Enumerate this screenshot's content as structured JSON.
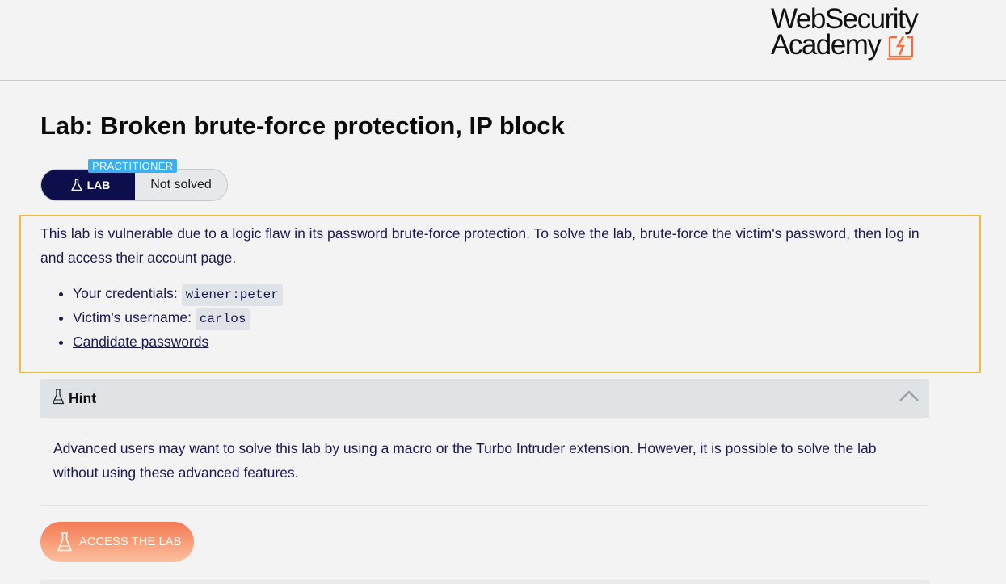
{
  "logo": {
    "line1": "WebSecurity",
    "line2": "Academy",
    "accent_color": "#ff6633"
  },
  "lab": {
    "title": "Lab: Broken brute-force protection, IP block",
    "badge_label": "LAB",
    "level": "PRACTITIONER",
    "status": "Not solved",
    "level_color": "#3ab0f3",
    "badge_color": "#0d0f4d"
  },
  "description": {
    "paragraph": "This lab is vulnerable due to a logic flaw in its password brute-force protection. To solve the lab, brute-force the victim's password, then log in and access their account page.",
    "items": [
      {
        "label": "Your credentials: ",
        "code": "wiener:peter"
      },
      {
        "label": "Victim's username: ",
        "code": "carlos"
      }
    ],
    "link_label": "Candidate passwords",
    "highlight_color": "#f6ba3c"
  },
  "hint": {
    "label": "Hint",
    "text": "Advanced users may want to solve this lab by using a macro or the Turbo Intruder extension. However, it is possible to solve the lab without using these advanced features.",
    "expanded": true
  },
  "actions": {
    "access_label": "ACCESS THE LAB",
    "access_color": "#f47a55"
  },
  "icons": {
    "flask": "flask-icon",
    "chevron": "chevron-up-icon",
    "logo_bolt": "lightning-bolt-icon"
  }
}
